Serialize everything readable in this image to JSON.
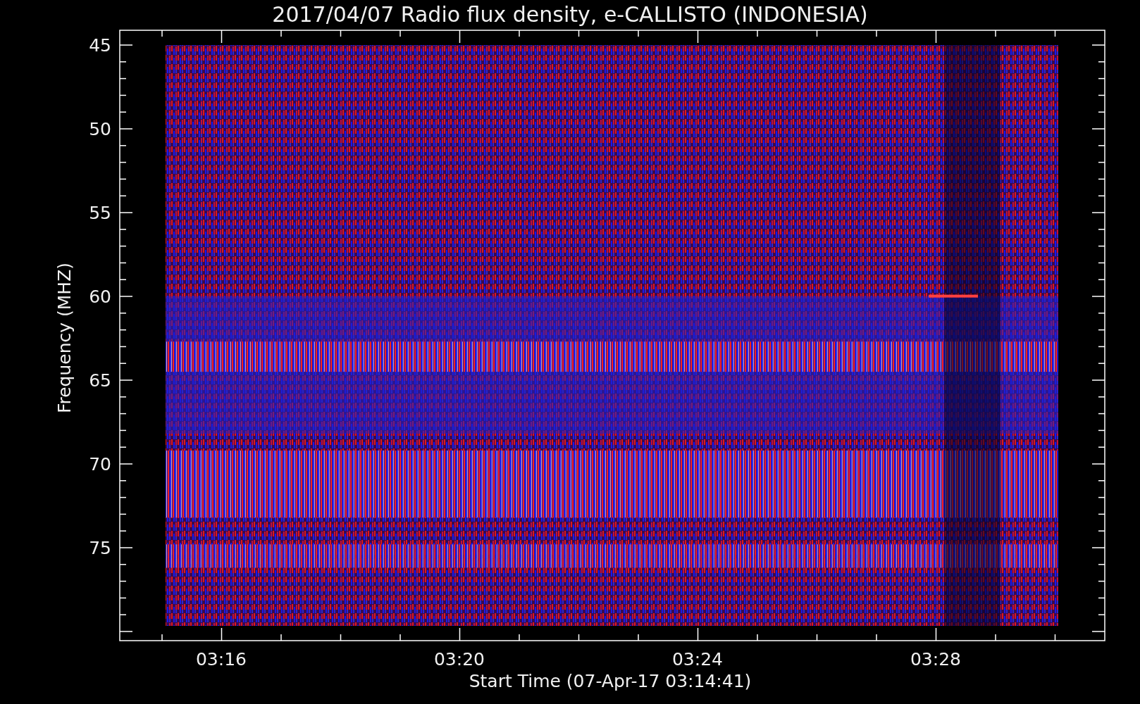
{
  "title": "2017/04/07  Radio flux density, e-CALLISTO (INDONESIA)",
  "y_axis": {
    "label": "Frequency (MHZ)",
    "ticks": [
      "45",
      "50",
      "55",
      "60",
      "65",
      "70",
      "75"
    ]
  },
  "x_axis": {
    "label": "Start Time (07-Apr-17 03:14:41)",
    "ticks": [
      "03:16",
      "03:20",
      "03:24",
      "03:28"
    ]
  }
}
